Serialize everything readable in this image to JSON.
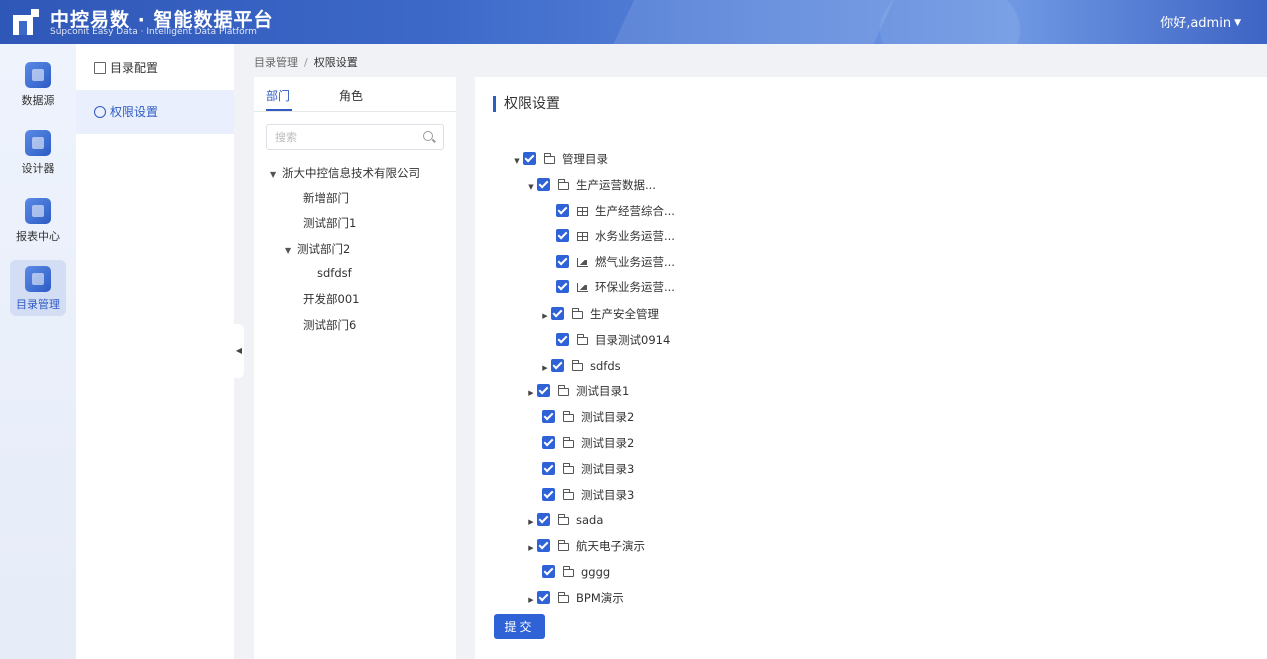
{
  "header": {
    "brand_title": "中控易数 · 智能数据平台",
    "brand_subtitle": "Supconit Easy Data · Intelligent Data Platform",
    "user_greeting": "你好,admin"
  },
  "rail": {
    "items": [
      {
        "label": "数据源",
        "icon": "database-icon"
      },
      {
        "label": "设计器",
        "icon": "designer-icon"
      },
      {
        "label": "报表中心",
        "icon": "report-icon"
      },
      {
        "label": "目录管理",
        "icon": "catalog-icon"
      }
    ]
  },
  "submenu": {
    "items": [
      {
        "label": "目录配置",
        "icon": "document-icon"
      },
      {
        "label": "权限设置",
        "icon": "user-circle-icon"
      }
    ]
  },
  "breadcrumb": {
    "parent": "目录管理",
    "separator": "/",
    "current": "权限设置"
  },
  "dept_panel": {
    "tabs": [
      "部门",
      "角色"
    ],
    "search_placeholder": "搜索",
    "nodes": [
      "浙大中控信息技术有限公司",
      "新增部门",
      "测试部门1",
      "测试部门2",
      "sdfdsf",
      "开发部001",
      "测试部门6"
    ]
  },
  "perm_panel": {
    "title": "权限设置",
    "tree": [
      {
        "label": "管理目录",
        "icon": "folder"
      },
      {
        "label": "生产运营数据...",
        "icon": "folder"
      },
      {
        "label": "生产经营综合...",
        "icon": "table"
      },
      {
        "label": "水务业务运营...",
        "icon": "table"
      },
      {
        "label": "燃气业务运营...",
        "icon": "chart"
      },
      {
        "label": "环保业务运营...",
        "icon": "chart"
      },
      {
        "label": "生产安全管理",
        "icon": "folder"
      },
      {
        "label": "目录测试0914",
        "icon": "folder"
      },
      {
        "label": "sdfds",
        "icon": "folder"
      },
      {
        "label": "测试目录1",
        "icon": "folder"
      },
      {
        "label": "测试目录2",
        "icon": "folder"
      },
      {
        "label": "测试目录2",
        "icon": "folder"
      },
      {
        "label": "测试目录3",
        "icon": "folder"
      },
      {
        "label": "测试目录3",
        "icon": "folder"
      },
      {
        "label": "sada",
        "icon": "folder"
      },
      {
        "label": "航天电子演示",
        "icon": "folder"
      },
      {
        "label": "gggg",
        "icon": "folder"
      },
      {
        "label": "BPM演示",
        "icon": "folder"
      }
    ],
    "submit_label": "提交"
  },
  "colors": {
    "primary": "#2f62d6",
    "header_start": "#2f57b8",
    "active_menu_bg": "#e9effc"
  }
}
